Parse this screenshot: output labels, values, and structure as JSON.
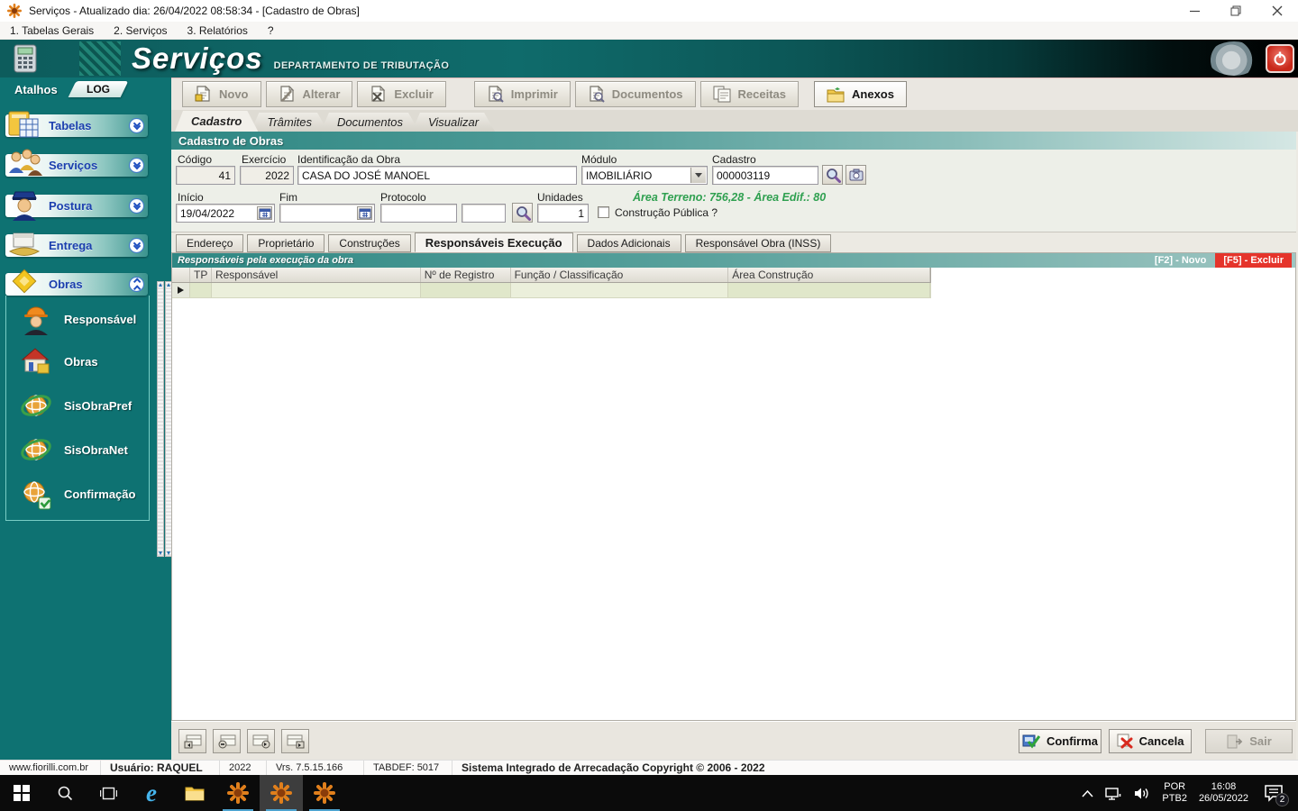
{
  "colors": {
    "teal": "#0e7272",
    "section_teal": "#2e8783",
    "delete_red": "#e5342b",
    "area_green": "#2fa050",
    "taskbar_accent": "#4da3cf"
  },
  "window": {
    "title": "Serviços - Atualizado dia: 26/04/2022 08:58:34 - [Cadastro de Obras]"
  },
  "menu": {
    "items": [
      "1. Tabelas Gerais",
      "2. Serviços",
      "3. Relatórios",
      "?"
    ]
  },
  "banner": {
    "title": "Serviços",
    "subtitle": "DEPARTAMENTO DE TRIBUTAÇÃO"
  },
  "sidebar": {
    "shortcuts_label": "Atalhos",
    "log_label": "LOG",
    "groups": [
      {
        "label": "Tabelas"
      },
      {
        "label": "Serviços"
      },
      {
        "label": "Postura"
      },
      {
        "label": "Entrega"
      },
      {
        "label": "Obras"
      }
    ],
    "obras_items": [
      {
        "label": "Responsável"
      },
      {
        "label": "Obras"
      },
      {
        "label": "SisObraPref"
      },
      {
        "label": "SisObraNet"
      },
      {
        "label": "Confirmação"
      }
    ]
  },
  "toolbar": {
    "buttons": [
      {
        "label": "Novo"
      },
      {
        "label": "Alterar"
      },
      {
        "label": "Excluir"
      },
      {
        "label": "Imprimir"
      },
      {
        "label": "Documentos"
      },
      {
        "label": "Receitas"
      },
      {
        "label": "Anexos"
      }
    ]
  },
  "tabs": [
    {
      "label": "Cadastro"
    },
    {
      "label": "Trâmites"
    },
    {
      "label": "Documentos"
    },
    {
      "label": "Visualizar"
    }
  ],
  "section": {
    "title": "Cadastro de Obras"
  },
  "form": {
    "codigo": {
      "label": "Código",
      "value": "41"
    },
    "exercicio": {
      "label": "Exercício",
      "value": "2022"
    },
    "identificacao": {
      "label": "Identificação da Obra",
      "value": "CASA DO JOSÉ MANOEL"
    },
    "modulo": {
      "label": "Módulo",
      "value": "IMOBILIÁRIO"
    },
    "cadastro": {
      "label": "Cadastro",
      "value": "000003119"
    },
    "inicio": {
      "label": "Início",
      "value": "19/04/2022"
    },
    "fim": {
      "label": "Fim",
      "value": ""
    },
    "protocolo": {
      "label": "Protocolo",
      "value": "",
      "value2": ""
    },
    "unidades": {
      "label": "Unidades",
      "value": "1"
    },
    "area_info": "Área Terreno: 756,28 - Área Edif.: 80",
    "construcao_publica_label": "Construção Pública ?",
    "construcao_publica_checked": false
  },
  "subtabs": [
    {
      "label": "Endereço"
    },
    {
      "label": "Proprietário"
    },
    {
      "label": "Construções"
    },
    {
      "label": "Responsáveis Execução"
    },
    {
      "label": "Dados Adicionais"
    },
    {
      "label": "Responsável Obra (INSS)"
    }
  ],
  "grid": {
    "caption": "Responsáveis pela execução da obra",
    "shortcut_new": "[F2] - Novo",
    "shortcut_delete": "[F5] - Excluir",
    "columns": [
      {
        "label": "TP"
      },
      {
        "label": "Responsável"
      },
      {
        "label": "Nº de Registro"
      },
      {
        "label": "Função / Classificação"
      },
      {
        "label": "Área Construção"
      }
    ],
    "rows": [
      {
        "tp": "",
        "responsavel": "",
        "no_registro": "",
        "funcao_classificacao": "",
        "area_construcao": ""
      }
    ]
  },
  "footer_buttons": {
    "confirma": "Confirma",
    "cancela": "Cancela",
    "sair": "Sair"
  },
  "statusbar": {
    "segments": [
      {
        "text": "www.fiorilli.com.br"
      },
      {
        "text": "Usuário: RAQUEL"
      },
      {
        "text": "2022"
      },
      {
        "text": "Vrs. 7.5.15.166"
      },
      {
        "text": "TABDEF: 5017"
      },
      {
        "text": "Sistema Integrado de Arrecadação Copyright © 2006 - 2022"
      }
    ]
  },
  "taskbar": {
    "lang_line1": "POR",
    "lang_line2": "PTB2",
    "time": "16:08",
    "date": "26/05/2022",
    "notification_count": "2"
  }
}
